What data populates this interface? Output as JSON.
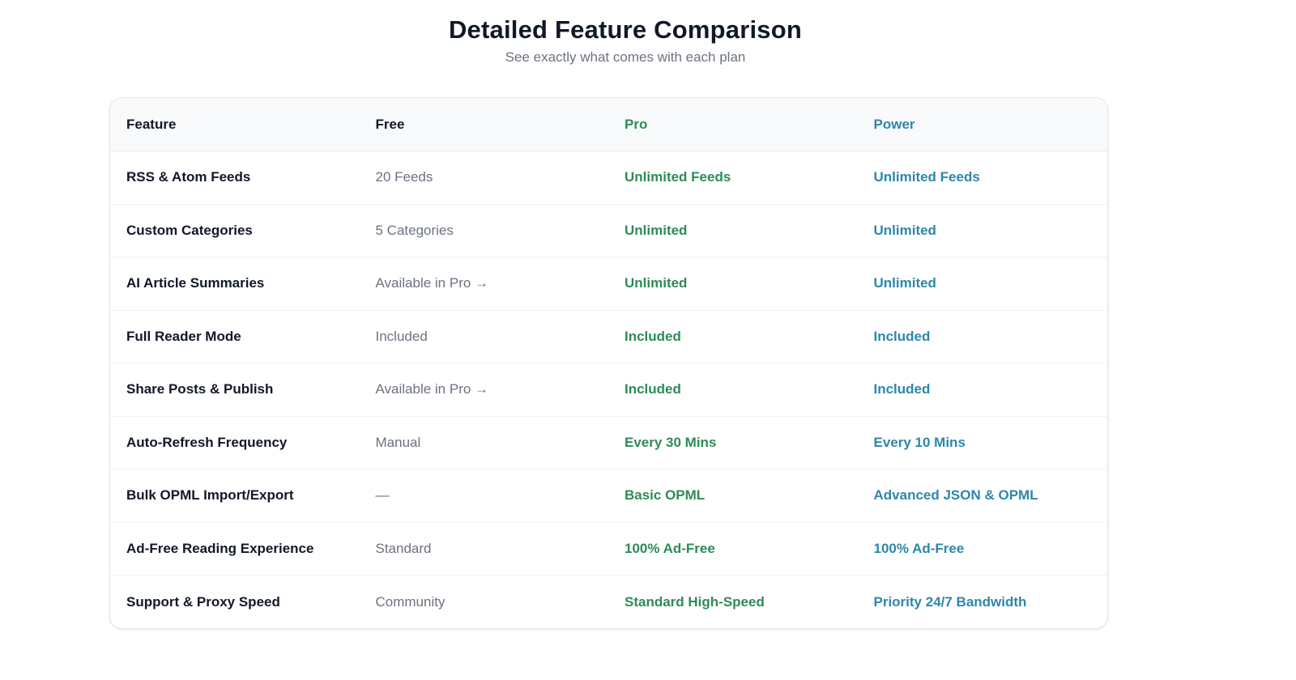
{
  "header": {
    "title": "Detailed Feature Comparison",
    "subtitle": "See exactly what comes with each plan"
  },
  "colors": {
    "pro": "#2e8b57",
    "power": "#2e86ab",
    "muted": "#6b7280",
    "text": "#111827"
  },
  "table": {
    "columns": [
      "Feature",
      "Free",
      "Pro",
      "Power"
    ],
    "rows": [
      [
        "RSS & Atom Feeds",
        "20 Feeds",
        "Unlimited Feeds",
        "Unlimited Feeds"
      ],
      [
        "Custom Categories",
        "5 Categories",
        "Unlimited",
        "Unlimited"
      ],
      [
        "AI Article Summaries",
        "Available in Pro →",
        "Unlimited",
        "Unlimited"
      ],
      [
        "Full Reader Mode",
        "Included",
        "Included",
        "Included"
      ],
      [
        "Share Posts & Publish",
        "Available in Pro →",
        "Included",
        "Included"
      ],
      [
        "Auto-Refresh Frequency",
        "Manual",
        "Every 30 Mins",
        "Every 10 Mins"
      ],
      [
        "Bulk OPML Import/Export",
        "—",
        "Basic OPML",
        "Advanced JSON & OPML"
      ],
      [
        "Ad-Free Reading Experience",
        "Standard",
        "100% Ad-Free",
        "100% Ad-Free"
      ],
      [
        "Support & Proxy Speed",
        "Community",
        "Standard High-Speed",
        "Priority 24/7 Bandwidth"
      ]
    ]
  }
}
